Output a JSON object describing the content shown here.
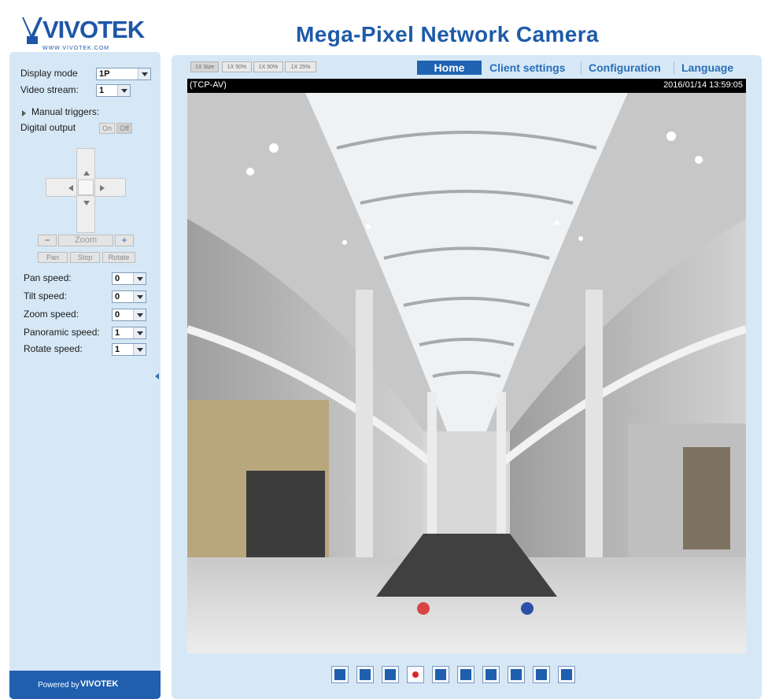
{
  "header": {
    "logo_text": "VIVOTEK",
    "logo_sub": "WWW.VIVOTEK.COM",
    "title": "Mega-Pixel Network Camera"
  },
  "sidebar": {
    "display_mode_label": "Display mode",
    "display_mode_value": "1P",
    "video_stream_label": "Video stream:",
    "video_stream_value": "1",
    "manual_triggers_label": "Manual triggers:",
    "digital_output_label": "Digital output",
    "do_on": "On",
    "do_off": "Off",
    "zoom_label": "Zoom",
    "zoom_minus": "−",
    "zoom_plus": "+",
    "pan_button": "Pan",
    "stop_button": "Stop",
    "rotate_button": "Rotate",
    "speeds": [
      {
        "label": "Pan speed:",
        "value": "0"
      },
      {
        "label": "Tilt speed:",
        "value": "0"
      },
      {
        "label": "Zoom speed:",
        "value": "0"
      },
      {
        "label": "Panoramic speed:",
        "value": "1"
      },
      {
        "label": "Rotate speed:",
        "value": "1"
      }
    ],
    "powered_by_label": "Powered by",
    "powered_by_brand": "VIVOTEK"
  },
  "toolbar": {
    "size_buttons": [
      "1X Size",
      "1X 50%",
      "1X 50%",
      "1X 25%"
    ]
  },
  "nav": {
    "home": "Home",
    "client_settings": "Client settings",
    "configuration": "Configuration",
    "language": "Language"
  },
  "video": {
    "protocol": "(TCP-AV)",
    "timestamp": "2016/01/14 13:59:05"
  },
  "controls": [
    {
      "name": "snapshot-icon"
    },
    {
      "name": "pause-icon"
    },
    {
      "name": "stop-icon"
    },
    {
      "name": "record-icon"
    },
    {
      "name": "volume-icon"
    },
    {
      "name": "mute-icon"
    },
    {
      "name": "talk-icon"
    },
    {
      "name": "mic-icon"
    },
    {
      "name": "microphone-icon"
    },
    {
      "name": "fullscreen-icon"
    }
  ],
  "colors": {
    "brand_blue": "#1e5ba8",
    "panel_bg": "#d6e8f6",
    "nav_active": "#1f63b2",
    "nav_text": "#2a6eb8"
  }
}
